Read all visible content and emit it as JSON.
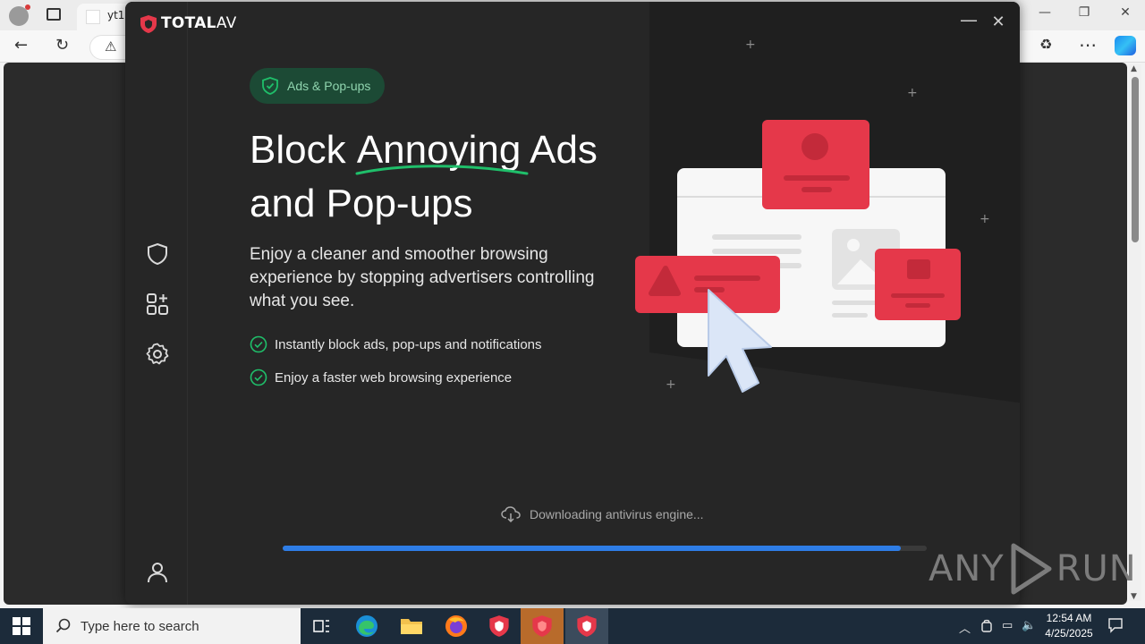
{
  "browser": {
    "tab_title": "yt1",
    "min_glyph": "—",
    "max_glyph": "❐",
    "close_glyph": "✕",
    "back_glyph": "←",
    "reload_glyph": "↻",
    "warn_glyph": "⚠",
    "extensions_glyph": "♻",
    "more_glyph": "⋯",
    "scroll_up": "▲",
    "scroll_down": "▼"
  },
  "app": {
    "brand_bold": "TOTAL",
    "brand_light": "AV",
    "minimize_glyph": "—",
    "close_glyph": "✕",
    "pill_label": "Ads & Pop-ups",
    "headline_pre": "Block ",
    "headline_highlight": "Annoying",
    "headline_post": " Ads and Pop-ups",
    "description": "Enjoy a cleaner and smoother browsing experience by stopping advertisers controlling what you see.",
    "bullets": [
      "Instantly block ads, pop-ups and notifications",
      "Enjoy a faster web browsing experience"
    ],
    "status_text": "Downloading antivirus engine...",
    "progress": 0.96,
    "colors": {
      "accent_green": "#1fbf6a",
      "ad_red": "#e5384a",
      "progress_blue": "#2e7de6"
    }
  },
  "watermark": {
    "left": "ANY",
    "right": "RUN"
  },
  "taskbar": {
    "search_placeholder": "Type here to search",
    "time": "12:54 AM",
    "date": "4/25/2025",
    "tray_chevron": "︿",
    "tray_network": "▭",
    "tray_volume": "🔈"
  }
}
